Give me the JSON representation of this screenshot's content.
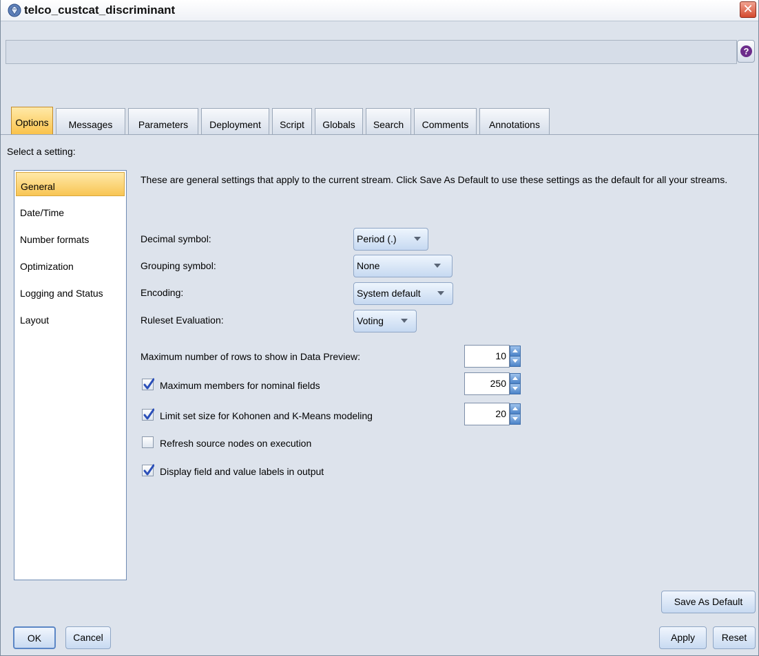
{
  "window": {
    "title": "telco_custcat_discriminant"
  },
  "tabs": [
    {
      "label": "Options"
    },
    {
      "label": "Messages"
    },
    {
      "label": "Parameters"
    },
    {
      "label": "Deployment"
    },
    {
      "label": "Script"
    },
    {
      "label": "Globals"
    },
    {
      "label": "Search"
    },
    {
      "label": "Comments"
    },
    {
      "label": "Annotations"
    }
  ],
  "select_label": "Select a setting:",
  "settings": [
    {
      "label": "General"
    },
    {
      "label": "Date/Time"
    },
    {
      "label": "Number formats"
    },
    {
      "label": "Optimization"
    },
    {
      "label": "Logging and Status"
    },
    {
      "label": "Layout"
    }
  ],
  "general": {
    "description": "These are general settings that apply to the current stream. Click Save As Default to use these settings as the default for all your streams.",
    "decimal_symbol": {
      "label": "Decimal symbol:",
      "value": "Period (.)"
    },
    "grouping_symbol": {
      "label": "Grouping symbol:",
      "value": "None"
    },
    "encoding": {
      "label": "Encoding:",
      "value": "System default"
    },
    "ruleset_evaluation": {
      "label": "Ruleset Evaluation:",
      "value": "Voting"
    },
    "max_rows_preview": {
      "label": "Maximum number of rows to show in Data Preview:",
      "value": "10"
    },
    "max_members_nominal": {
      "label": "Maximum members for nominal fields",
      "checked": true,
      "value": "250"
    },
    "limit_set_size": {
      "label": "Limit set size for Kohonen and K-Means modeling",
      "checked": true,
      "value": "20"
    },
    "refresh_source": {
      "label": "Refresh source nodes on execution",
      "checked": false
    },
    "display_labels": {
      "label": "Display field and value labels in output",
      "checked": true
    }
  },
  "buttons": {
    "save_default": "Save As Default",
    "ok": "OK",
    "cancel": "Cancel",
    "apply": "Apply",
    "reset": "Reset"
  },
  "colors": {
    "active_tab": "#fac34b",
    "selected_item": "#f8c554",
    "check_mark": "#2b4fb8",
    "close_button": "#d4492e",
    "help_icon": "#6c2d8b"
  }
}
